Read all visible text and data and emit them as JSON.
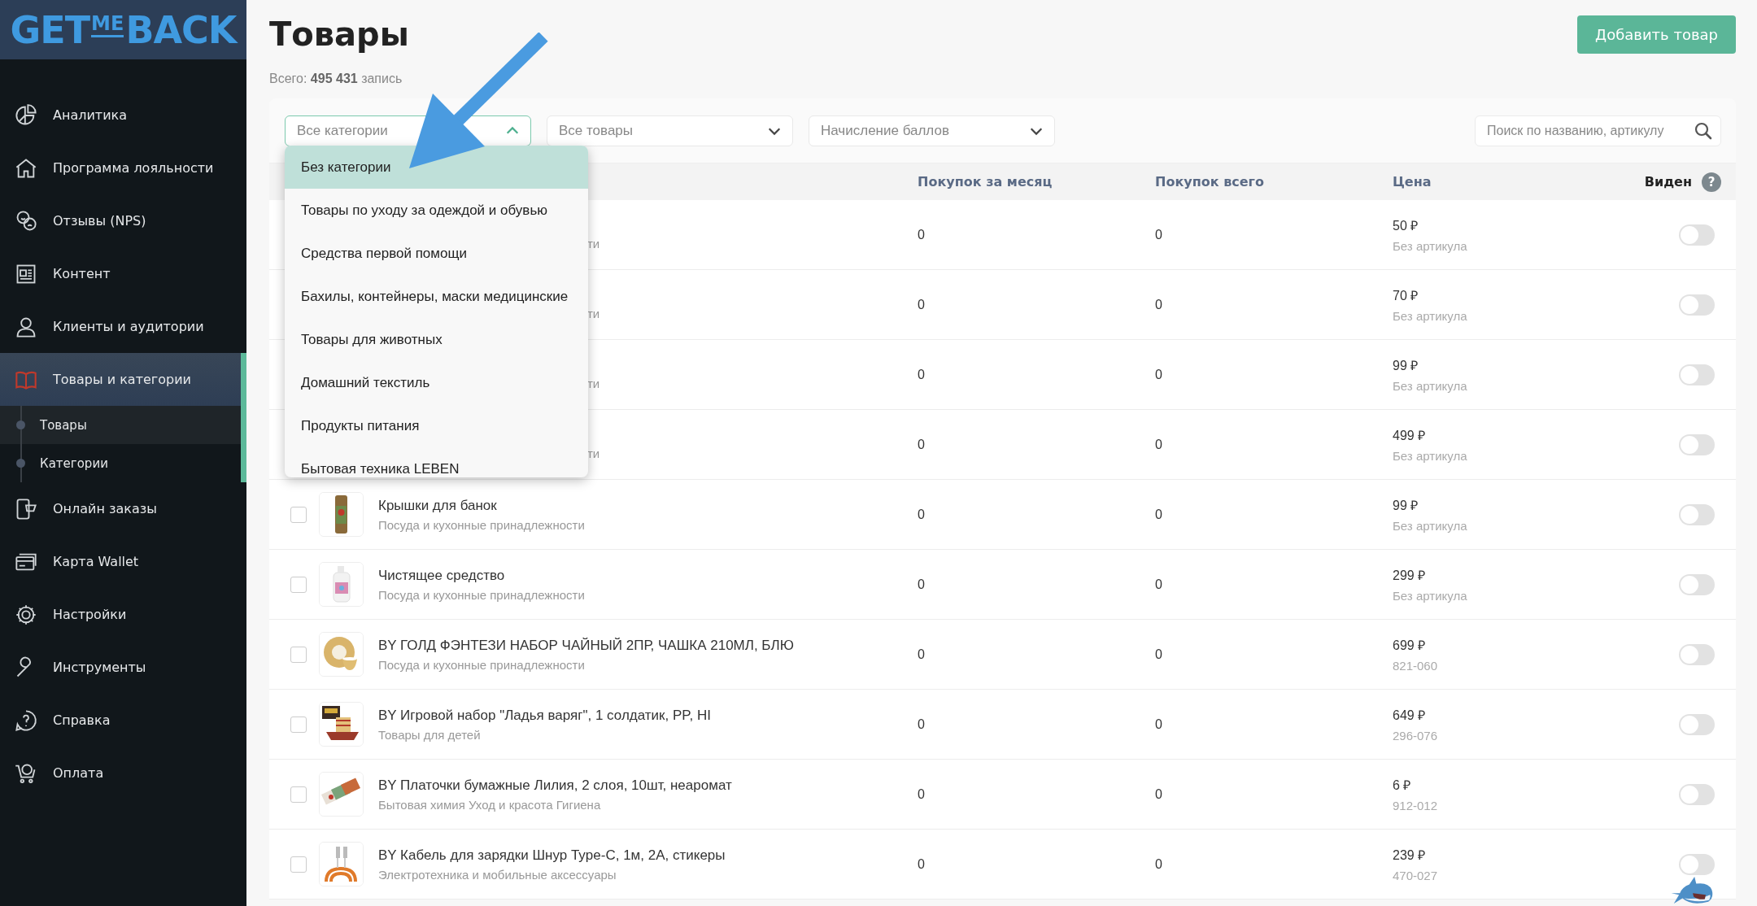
{
  "sidebar": {
    "logo": {
      "part_1": "GET",
      "part_2": "ME",
      "part_3": "BACK"
    },
    "items": [
      {
        "label": "Аналитика",
        "selected": false
      },
      {
        "label": "Программа лояльности",
        "selected": false
      },
      {
        "label": "Отзывы (NPS)",
        "selected": false
      },
      {
        "label": "Контент",
        "selected": false
      },
      {
        "label": "Клиенты и аудитории",
        "selected": false
      },
      {
        "label": "Товары и категории",
        "selected": true,
        "expanded": true,
        "children": [
          {
            "label": "Товары",
            "selected": true
          },
          {
            "label": "Категории",
            "selected": false
          }
        ]
      },
      {
        "label": "Онлайн заказы",
        "selected": false
      },
      {
        "label": "Карта Wallet",
        "selected": false
      },
      {
        "label": "Настройки",
        "selected": false
      },
      {
        "label": "Инструменты",
        "selected": false
      },
      {
        "label": "Справка",
        "selected": false
      },
      {
        "label": "Оплата",
        "selected": false
      }
    ]
  },
  "header": {
    "title": "Товары",
    "summary": "Всего: **495 431** запись",
    "add_button": "Добавить товар"
  },
  "filters": [
    {
      "placeholder": "Все категории",
      "expanded": true
    },
    {
      "placeholder": "Все товары",
      "expanded": false
    },
    {
      "placeholder": "Начисление баллов",
      "expanded": false
    }
  ],
  "search": {
    "placeholder": "Поиск по названию, артикулу"
  },
  "dropdown": {
    "options": [
      {
        "label": "Без категории",
        "selected": true
      },
      {
        "label": "Товары по уходу за одеждой и обувью",
        "selected": false
      },
      {
        "label": "Средства первой помощи",
        "selected": false
      },
      {
        "label": "Бахилы, контейнеры, маски медицинские",
        "selected": false
      },
      {
        "label": "Товары для животных",
        "selected": false
      },
      {
        "label": "Домашний текстиль",
        "selected": false
      },
      {
        "label": "Продукты питания",
        "selected": false
      },
      {
        "label": "Бытовая техника LEBEN",
        "selected": false
      }
    ]
  },
  "table": {
    "columns": [
      {
        "label": "Покупок за месяц"
      },
      {
        "label": "Покупок всего"
      },
      {
        "label": "Цена"
      },
      {
        "label": "Виден",
        "help": "?"
      }
    ],
    "rows": [
      {
        "kind": "covered",
        "category": "ти",
        "month": "0",
        "total": "0",
        "price": "50 ₽",
        "article": "Без артикула",
        "visible": false
      },
      {
        "kind": "covered",
        "category": "ти",
        "month": "0",
        "total": "0",
        "price": "70 ₽",
        "article": "Без артикула",
        "visible": false
      },
      {
        "kind": "covered",
        "category": "ти",
        "month": "0",
        "total": "0",
        "price": "99 ₽",
        "article": "Без артикула",
        "visible": false
      },
      {
        "kind": "covered",
        "category": "ти",
        "month": "0",
        "total": "0",
        "price": "499 ₽",
        "article": "Без артикула",
        "visible": false
      },
      {
        "kind": "item",
        "checked": false,
        "name": "Крышки для банок",
        "category": "Посуда и кухонные принадлежности",
        "month": "0",
        "total": "0",
        "price": "99 ₽",
        "article": "Без артикула",
        "visible": false
      },
      {
        "kind": "item",
        "checked": false,
        "name": "Чистящее средство",
        "category": "Посуда и кухонные принадлежности",
        "month": "0",
        "total": "0",
        "price": "299 ₽",
        "article": "Без артикула",
        "visible": false
      },
      {
        "kind": "item",
        "checked": false,
        "name": "BY ГОЛД ФЭНТЕЗИ НАБОР ЧАЙНЫЙ 2ПР, ЧАШКА 210МЛ, БЛЮ",
        "category": "Посуда и кухонные принадлежности",
        "month": "0",
        "total": "0",
        "price": "699 ₽",
        "article": "821-060",
        "visible": false
      },
      {
        "kind": "item",
        "checked": false,
        "name": "BY Игровой набор \"Ладья варяг\", 1 солдатик, PP, HI",
        "category": "Товары для детей",
        "month": "0",
        "total": "0",
        "price": "649 ₽",
        "article": "296-076",
        "visible": false
      },
      {
        "kind": "item",
        "checked": false,
        "name": "BY Платочки бумажные Лилия, 2 слоя, 10шт, неаромат",
        "category": "Бытовая химия Уход и красота Гигиена",
        "month": "0",
        "total": "0",
        "price": "6 ₽",
        "article": "912-012",
        "visible": false
      },
      {
        "kind": "item",
        "checked": false,
        "name": "BY Кабель для зарядки Шнур Type-C, 1м, 2A, стикеры",
        "category": "Электротехника и мобильные аксессуары",
        "month": "0",
        "total": "0",
        "price": "239 ₽",
        "article": "470-027",
        "visible": false
      }
    ]
  }
}
